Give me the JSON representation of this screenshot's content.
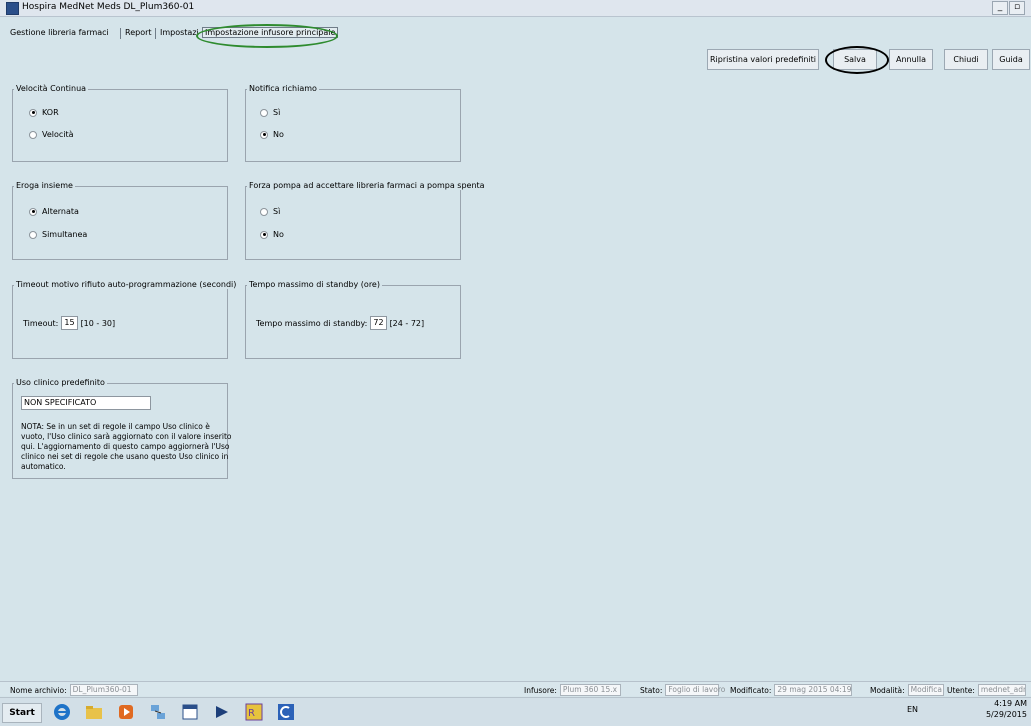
{
  "window": {
    "title": "Hospira MedNet Meds  DL_Plum360-01",
    "min_glyph": "_",
    "max_glyph": "▫"
  },
  "tabs": [
    {
      "label": "Gestione libreria farmaci"
    },
    {
      "label": "Report"
    },
    {
      "label": "Impostazione CCA"
    },
    {
      "label": "Impostazione infusore principale",
      "active": true
    }
  ],
  "toolbar": {
    "restore_defaults": "Ripristina valori predefiniti",
    "save": "Salva",
    "cancel": "Annulla",
    "close": "Chiudi",
    "help": "Guida"
  },
  "groups": {
    "continuous_rate": {
      "title": "Velocità Continua",
      "options": [
        "KOR",
        "Velocità"
      ],
      "selected": 0
    },
    "callback_notify": {
      "title": "Notifica richiamo",
      "options": [
        "Sì",
        "No"
      ],
      "selected": 1
    },
    "delivery_mode": {
      "title": "Eroga insieme",
      "options": [
        "Alternata",
        "Simultanea"
      ],
      "selected": 0
    },
    "force_pump": {
      "title": "Forza pompa ad accettare libreria farmaci a pompa spenta",
      "options": [
        "Sì",
        "No"
      ],
      "selected": 1
    },
    "timeout": {
      "title": "Timeout motivo rifiuto auto-programmazione (secondi)",
      "label": "Timeout:",
      "value": "15",
      "range": "[10 - 30]"
    },
    "standby": {
      "title": "Tempo massimo di standby (ore)",
      "label": "Tempo massimo di standby:",
      "value": "72",
      "range": "[24 - 72]"
    },
    "clinical_use": {
      "title": "Uso clinico predefinito",
      "value": "NON SPECIFICATO",
      "note": "NOTA: Se in un set di regole il campo Uso clinico è vuoto, l'Uso clinico sarà aggiornato con il valore inserito qui. L'aggiornamento di questo campo aggiornerà l'Uso clinico nei set di regole che usano questo Uso clinico in automatico."
    }
  },
  "status": {
    "archive_label": "Nome archivio:",
    "archive_value": "DL_Plum360-01",
    "infuser_label": "Infusore:",
    "infuser_value": "Plum 360 15.x",
    "state_label": "Stato:",
    "state_value": "Foglio di lavoro",
    "modified_label": "Modificato:",
    "modified_value": "29 mag 2015 04:19",
    "mode_label": "Modalità:",
    "mode_value": "Modifica",
    "user_label": "Utente:",
    "user_value": "mednet_admin"
  },
  "taskbar": {
    "start": "Start",
    "lang": "EN",
    "time": "4:19 AM",
    "date": "5/29/2015"
  }
}
